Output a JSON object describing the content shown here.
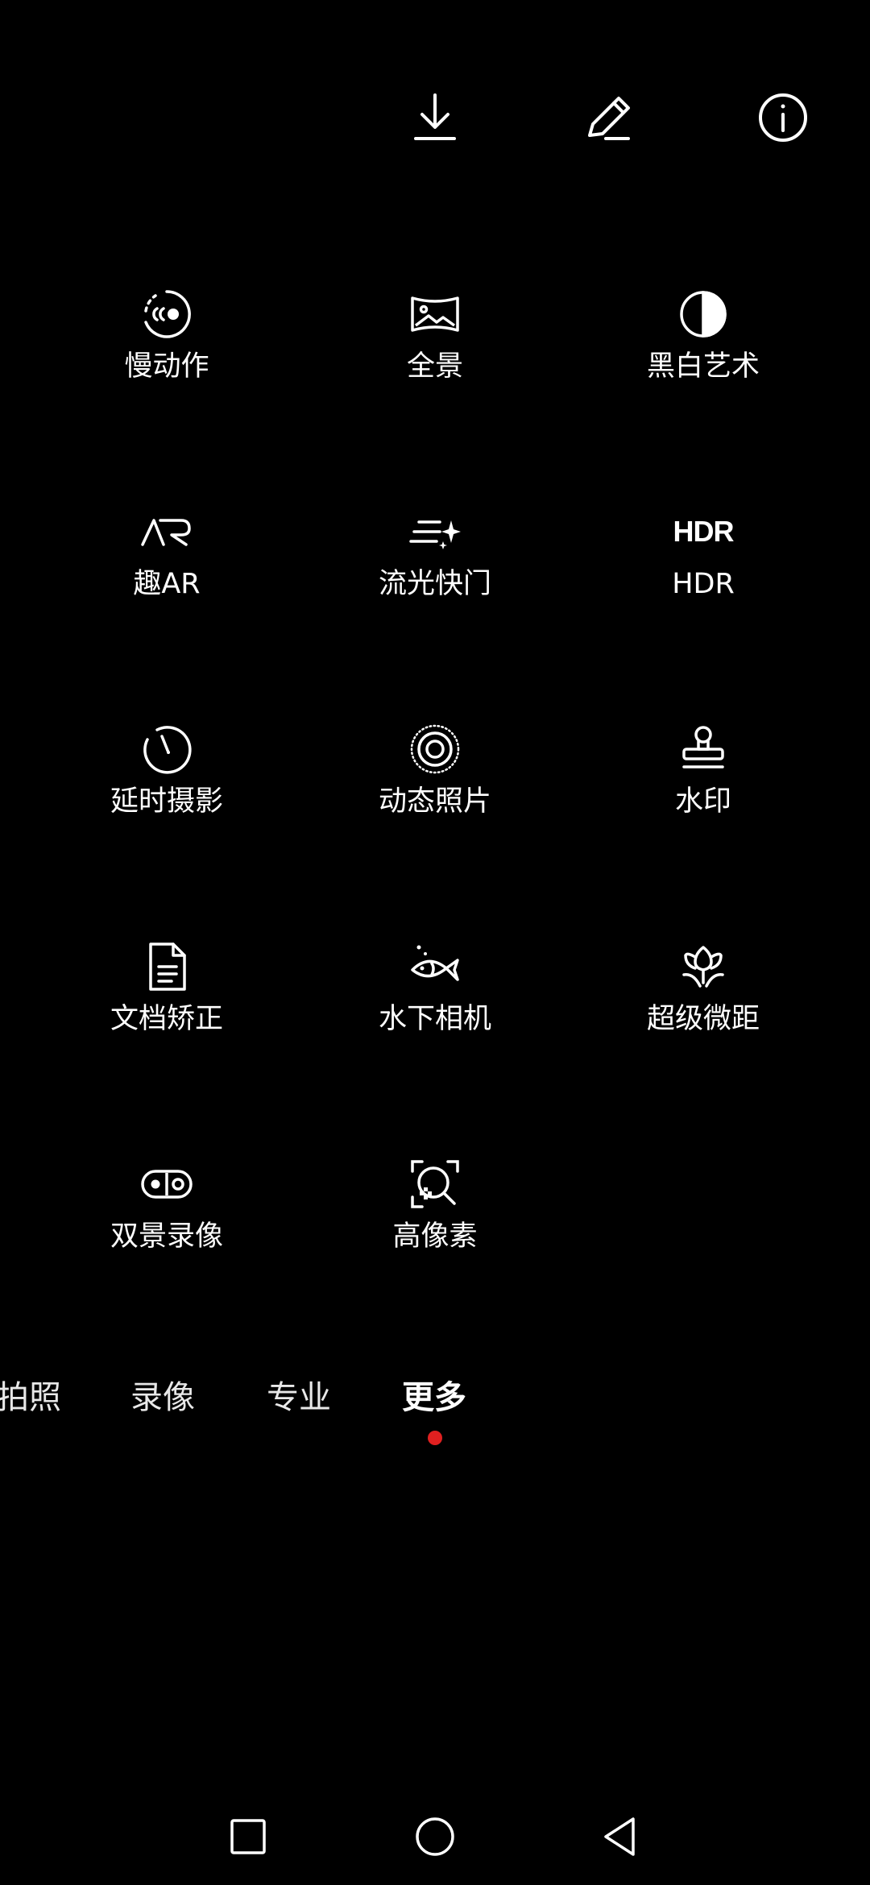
{
  "toolbar": {
    "icons": [
      "download-icon",
      "edit-pencil-icon",
      "info-icon"
    ]
  },
  "modes": [
    {
      "label": "慢动作",
      "icon": "slow-motion-icon"
    },
    {
      "label": "全景",
      "icon": "panorama-icon"
    },
    {
      "label": "黑白艺术",
      "icon": "black-white-art-icon"
    },
    {
      "label": "趣AR",
      "icon": "ar-icon"
    },
    {
      "label": "流光快门",
      "icon": "light-trail-shutter-icon"
    },
    {
      "label": "HDR",
      "icon": "hdr-icon",
      "icon_text": "HDR"
    },
    {
      "label": "延时摄影",
      "icon": "timelapse-icon"
    },
    {
      "label": "动态照片",
      "icon": "live-photo-icon"
    },
    {
      "label": "水印",
      "icon": "watermark-stamp-icon"
    },
    {
      "label": "文档矫正",
      "icon": "document-icon"
    },
    {
      "label": "水下相机",
      "icon": "fish-icon"
    },
    {
      "label": "超级微距",
      "icon": "macro-flower-icon"
    },
    {
      "label": "双景录像",
      "icon": "dual-view-icon"
    },
    {
      "label": "高像素",
      "icon": "high-resolution-icon"
    }
  ],
  "tabs": [
    {
      "label": "拍照"
    },
    {
      "label": "录像"
    },
    {
      "label": "专业"
    },
    {
      "label": "更多",
      "active": true
    }
  ],
  "colors": {
    "background": "#000000",
    "foreground": "#ffffff",
    "indicator": "#e02020"
  },
  "navbar": {
    "icons": [
      "recents-square-icon",
      "home-circle-icon",
      "back-triangle-icon"
    ]
  }
}
